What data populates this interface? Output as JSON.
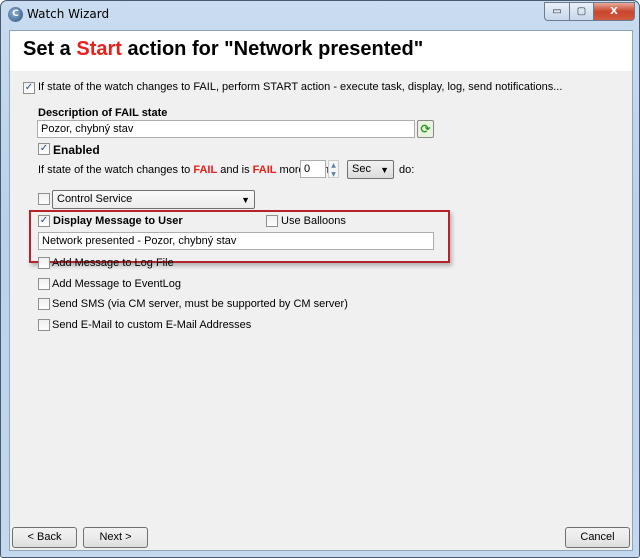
{
  "window": {
    "title": "Watch Wizard",
    "minimize": "▭",
    "maximize": "▢",
    "close": "X"
  },
  "header": {
    "title_pre": "Set a ",
    "title_action": "Start",
    "title_post": " action for \"Network presented\""
  },
  "main": {
    "perform_start": {
      "label": "If state of the watch changes to FAIL, perform START action - execute task, display, log, send notifications...",
      "checked": true
    },
    "description_label": "Description of FAIL state",
    "description_value": "Pozor, chybný stav",
    "refresh_icon": "refresh-icon",
    "enabled": {
      "label": "Enabled",
      "checked": true
    },
    "condition": {
      "pre": "If state of the watch changes to ",
      "fail1": "FAIL",
      "mid": " and is ",
      "fail2": "FAIL",
      "post": " more than",
      "value": "0",
      "unit": "Sec",
      "do": "do:"
    },
    "control_service": {
      "checked": false,
      "value": "Control Service"
    },
    "display_message": {
      "label": "Display Message to User",
      "checked": true,
      "use_balloons": "Use Balloons",
      "use_balloons_checked": false,
      "value": "Network presented - Pozor, chybný stav"
    },
    "options": [
      {
        "label": "Add Message to Log File",
        "checked": false
      },
      {
        "label": "Add Message to EventLog",
        "checked": false
      },
      {
        "label": "Send SMS (via CM server, must be supported by CM server)",
        "checked": false
      },
      {
        "label": "Send E-Mail to custom E-Mail Addresses",
        "checked": false
      }
    ],
    "check_glyph": "✓"
  },
  "footer": {
    "back": "< Back",
    "next": "Next >",
    "cancel": "Cancel"
  },
  "colors": {
    "accent_red": "#e8201b",
    "highlight_border": "#b6232a"
  }
}
